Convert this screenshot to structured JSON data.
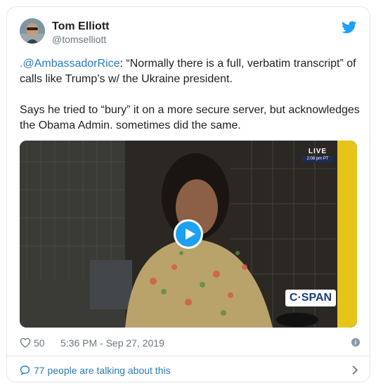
{
  "author": {
    "name": "Tom Elliott",
    "handle": "@tomselliott",
    "avatar_icon": "user-avatar-photo"
  },
  "tweet": {
    "mention": ".@AmbassadorRice",
    "line1_rest": ": “Normally there is a full, verbatim transcript” of calls like Trump’s w/ the Ukraine president.",
    "paragraph2": "Says he tried to “bury” it on a more secure server, but acknowledges the Obama Admin. sometimes did the same."
  },
  "video": {
    "live_label": "LIVE",
    "live_time": "2:08 pm PT",
    "network_logo": "C·SPAN",
    "play_icon": "play-icon"
  },
  "meta": {
    "likes": "50",
    "timestamp": "5:36 PM - Sep 27, 2019",
    "info_icon": "i"
  },
  "footer": {
    "talking_label": "77 people are talking about this"
  },
  "colors": {
    "link": "#2b7bb9",
    "twitter_blue": "#1da1f2",
    "muted": "#697882",
    "border": "#e1e8ed"
  }
}
